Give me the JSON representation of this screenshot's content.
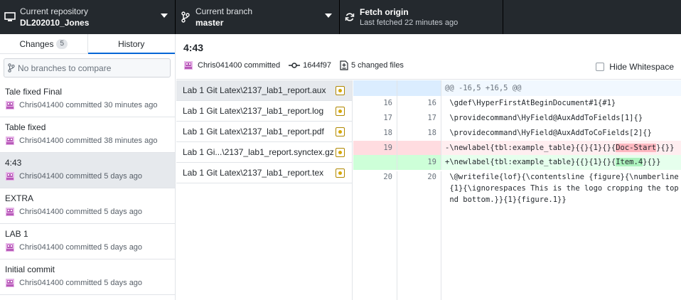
{
  "toolbar": {
    "repository": {
      "label": "Current repository",
      "value": "DL202010_Jones"
    },
    "branch": {
      "label": "Current branch",
      "value": "master"
    },
    "fetch": {
      "label": "Fetch origin",
      "sub": "Last fetched 22 minutes ago"
    }
  },
  "sidebar": {
    "tabs": [
      {
        "label": "Changes",
        "count": "5"
      },
      {
        "label": "History"
      }
    ],
    "compare_placeholder": "No branches to compare",
    "commits": [
      {
        "title": "Tale fixed Final",
        "meta": "Chris041400 committed 30 minutes ago"
      },
      {
        "title": "Table fixed",
        "meta": "Chris041400 committed 38 minutes ago"
      },
      {
        "title": "4:43",
        "meta": "Chris041400 committed 5 days ago"
      },
      {
        "title": "EXTRA",
        "meta": "Chris041400 committed 5 days ago"
      },
      {
        "title": "LAB 1",
        "meta": "Chris041400 committed 5 days ago"
      },
      {
        "title": "Initial commit",
        "meta": "Chris041400 committed 5 days ago"
      }
    ]
  },
  "commit_header": {
    "title": "4:43",
    "author": "Chris041400 committed",
    "sha": "1644f97",
    "changed_files": "5 changed files",
    "hide_whitespace": "Hide Whitespace"
  },
  "files": [
    "Lab 1 Git Latex\\2137_lab1_report.aux",
    "Lab 1 Git Latex\\2137_lab1_report.log",
    "Lab 1 Git Latex\\2137_lab1_report.pdf",
    "Lab 1 Gi...\\2137_lab1_report.synctex.gz",
    "Lab 1 Git Latex\\2137_lab1_report.tex"
  ],
  "diff": {
    "hunk": "@@ -16,5 +16,5 @@",
    "lines": [
      {
        "old": "16",
        "new": "16",
        "text": " \\gdef\\HyperFirstAtBeginDocument#1{#1}"
      },
      {
        "old": "17",
        "new": "17",
        "text": " \\providecommand\\HyField@AuxAddToFields[1]{}"
      },
      {
        "old": "18",
        "new": "18",
        "text": " \\providecommand\\HyField@AuxAddToCoFields[2]{}"
      },
      {
        "old": "19",
        "new": "",
        "pre": "-\\newlabel{tbl:example_table}{{}{1}{}{",
        "hl": "Doc-Start",
        "post": "}{}}"
      },
      {
        "old": "",
        "new": "19",
        "pre": "+\\newlabel{tbl:example_table}{{}{1}{}{",
        "hl": "Item.4",
        "post": "}{}}"
      },
      {
        "old": "20",
        "new": "20",
        "text": " \\@writefile{lof}{\\contentsline {figure}{\\numberline\n {1}{\\ignorespaces This is the logo cropping the top a\n nd bottom.}}{1}{figure.1}}"
      }
    ]
  },
  "colors": {
    "toolbar_bg": "#24292e",
    "accent": "#0366d6",
    "deleted": "#ffeef0",
    "added": "#e6ffed"
  }
}
